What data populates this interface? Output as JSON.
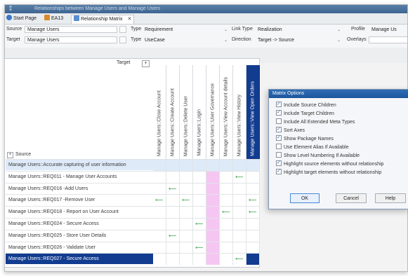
{
  "window": {
    "title": "Relationships between Manage Users and Manage Users"
  },
  "tabs": [
    {
      "label": "Start Page",
      "icon": "globe-icon"
    },
    {
      "label": "EA13",
      "icon": "package-icon"
    },
    {
      "label": "Relationship Matrix",
      "icon": "matrix-icon",
      "close": "✕"
    }
  ],
  "filters": {
    "source_label": "Source",
    "source_value": "Manage Users",
    "target_label": "Target",
    "target_value": "Manage Users",
    "type_label": "Type",
    "source_type": "Requirement",
    "target_type": "UseCase",
    "link_type_label": "Link Type",
    "link_type_value": "Realization",
    "direction_label": "Direction",
    "direction_value": "Target -> Source",
    "profile_label": "Profile",
    "profile_value": "Manage Us",
    "overlays_label": "Overlays"
  },
  "matrix": {
    "target_label": "Target",
    "source_label": "Source",
    "expand_symbol": "+",
    "columns": [
      "Manage Users::Close Account",
      "Manage Users::Create Account",
      "Manage Users::Delete User",
      "Manage Users::Login",
      "Manage Users::User Governance",
      "Manage Users::View Account details",
      "Manage Users::View History",
      "Manage Users::View Open Orders"
    ],
    "rows": [
      "Manage Users::Accurate capturing of user information",
      "Manage Users::REQ011 - Manage User Accounts",
      "Manage Users::REQ016 -Add Users",
      "Manage Users::REQ017 -Remove User",
      "Manage Users::REQ018 - Report on User Account",
      "Manage Users::REQ024 - Secure Access",
      "Manage Users::REQ025 - Store User Details",
      "Manage Users::REQ026 - Validate User",
      "Manage Users::REQ027 - Secure Access"
    ],
    "arrow_symbol": "⟵",
    "links": [
      [
        1,
        6
      ],
      [
        2,
        1
      ],
      [
        3,
        0
      ],
      [
        3,
        2
      ],
      [
        3,
        7
      ],
      [
        4,
        5
      ],
      [
        4,
        7
      ],
      [
        5,
        3
      ],
      [
        6,
        1
      ],
      [
        7,
        3
      ],
      [
        8,
        6
      ]
    ],
    "selected_row": 8,
    "selected_column": 7,
    "highlight_row": 0,
    "pink_column": 4
  },
  "dialog": {
    "title": "Matrix Options",
    "options": [
      {
        "label": "Include Source Children",
        "checked": true
      },
      {
        "label": "Include Target Children",
        "checked": true
      },
      {
        "label": "Include All Extended Meta Types",
        "checked": false
      },
      {
        "label": "Sort Axes",
        "checked": true
      },
      {
        "label": "Show Package Names",
        "checked": true
      },
      {
        "label": "Use Element Alias If Available",
        "checked": false
      },
      {
        "label": "Show Level Numbering If Available",
        "checked": false
      },
      {
        "label": "Highlight source elements without relationship",
        "checked": true
      },
      {
        "label": "Highlight target elements without relationship",
        "checked": true
      }
    ],
    "ok_label": "OK",
    "cancel_label": "Cancel",
    "help_label": "Help"
  },
  "colors": {
    "selection": "#123c8f",
    "highlight": "#deeaf8",
    "pink": "#f6c6f3",
    "arrow": "#3fa34d"
  }
}
